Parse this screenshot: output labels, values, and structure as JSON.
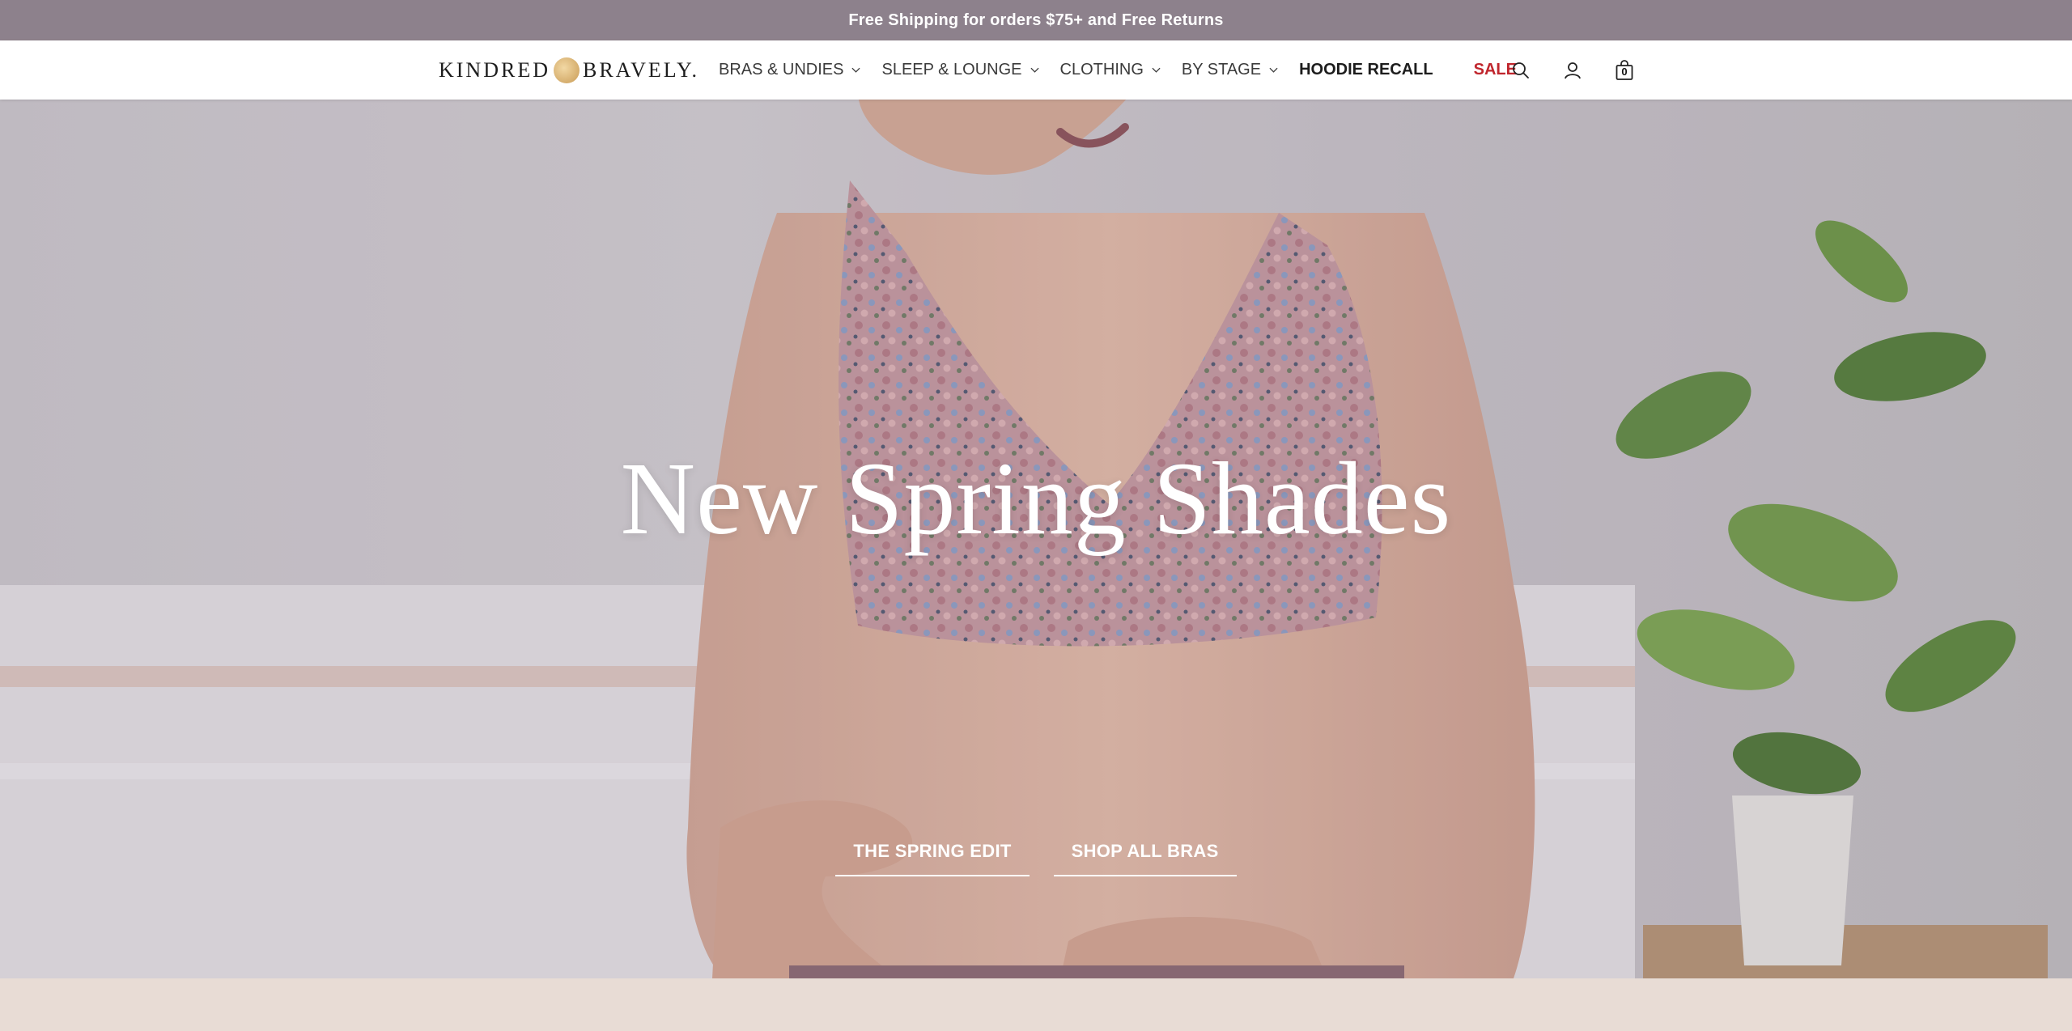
{
  "promo": {
    "text": "Free Shipping for orders $75+ and Free Returns"
  },
  "header": {
    "logo": {
      "left": "KINDRED",
      "right": "BRAVELY."
    },
    "nav": [
      {
        "label": "BRAS & UNDIES",
        "has_dropdown": true
      },
      {
        "label": "SLEEP & LOUNGE",
        "has_dropdown": true
      },
      {
        "label": "CLOTHING",
        "has_dropdown": true
      },
      {
        "label": "BY STAGE",
        "has_dropdown": true
      },
      {
        "label": "HOODIE RECALL",
        "has_dropdown": false
      },
      {
        "label": "SALE",
        "has_dropdown": false
      }
    ],
    "icons": {
      "search": "search-icon",
      "account": "account-icon",
      "cart": "cart-icon"
    },
    "cart_count": "0"
  },
  "hero": {
    "title": "New Spring Shades",
    "ctas": [
      {
        "label": "THE SPRING EDIT"
      },
      {
        "label": "SHOP ALL BRAS"
      }
    ]
  },
  "colors": {
    "promo_bg": "#8d818c",
    "sale": "#c0262d",
    "bottom_band": "#e8dcd5"
  }
}
